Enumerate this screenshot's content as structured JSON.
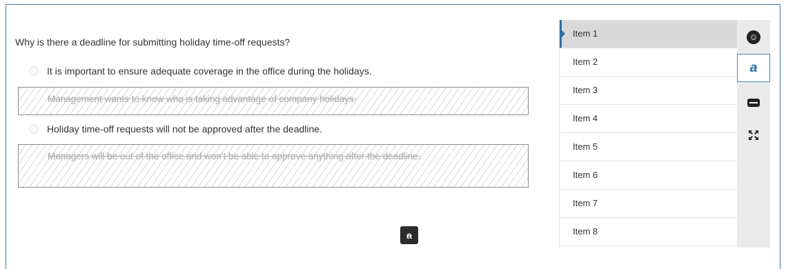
{
  "question": {
    "text": "Why is there a deadline for submitting holiday time-off requests?"
  },
  "options": [
    {
      "text": "It is important to ensure adequate coverage in the office during the holidays.",
      "state": "unselected"
    },
    {
      "text": "Management wants to know who is taking advantage of company holidays.",
      "state": "eliminated"
    },
    {
      "text": "Holiday time-off requests will not be approved after the deadline.",
      "state": "unselected"
    },
    {
      "text": "Managers will be out of the office and won't be able to approve anything after the deadline.",
      "state": "eliminated"
    }
  ],
  "bottom_tool": {
    "icon": "strikethrough-icon",
    "glyph": "a"
  },
  "items": [
    {
      "label": "Item 1",
      "active": true
    },
    {
      "label": "Item 2",
      "active": false
    },
    {
      "label": "Item 3",
      "active": false
    },
    {
      "label": "Item 4",
      "active": false
    },
    {
      "label": "Item 5",
      "active": false
    },
    {
      "label": "Item 6",
      "active": false
    },
    {
      "label": "Item 7",
      "active": false
    },
    {
      "label": "Item 8",
      "active": false
    }
  ],
  "toolbar": [
    {
      "icon": "accessibility-icon",
      "selected": false
    },
    {
      "icon": "strikethrough-icon",
      "selected": true
    },
    {
      "icon": "line-reader-icon",
      "selected": false
    },
    {
      "icon": "expand-icon",
      "selected": false
    }
  ],
  "colors": {
    "accent": "#2a6fa8",
    "frame": "#3b77a8",
    "active_item": "#d9d9d9",
    "toolbar_bg": "#eaeaea"
  }
}
